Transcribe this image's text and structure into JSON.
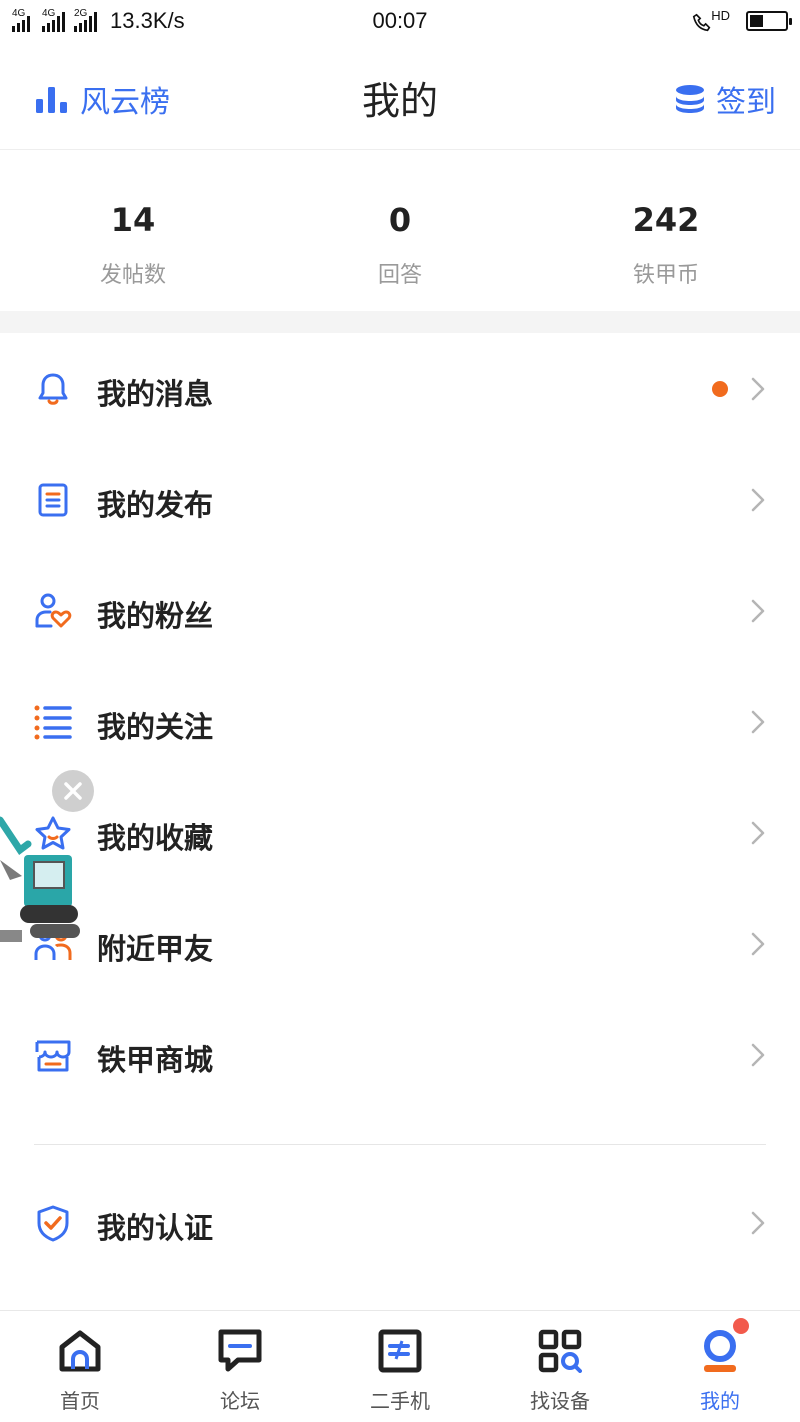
{
  "status_bar": {
    "sim1_tag": "4G",
    "sim2_tag": "4G",
    "sim3_tag": "2G",
    "net_speed": "13.3K/s",
    "time": "00:07",
    "call_tag": "HD",
    "battery_level": 0.35
  },
  "header": {
    "left_label": "风云榜",
    "left_icon": "bar-chart-icon",
    "title": "我的",
    "right_label": "签到",
    "right_icon": "coin-stack-icon",
    "accent_color": "#3a6ff0"
  },
  "stats": [
    {
      "value": "14",
      "label": "发帖数"
    },
    {
      "value": "0",
      "label": "回答"
    },
    {
      "value": "242",
      "label": "铁甲币"
    }
  ],
  "menu": {
    "items": [
      {
        "label": "我的消息",
        "icon": "bell-icon",
        "has_dot": true
      },
      {
        "label": "我的发布",
        "icon": "document-icon"
      },
      {
        "label": "我的粉丝",
        "icon": "fans-icon"
      },
      {
        "label": "我的关注",
        "icon": "list-icon"
      },
      {
        "label": "我的收藏",
        "icon": "star-icon"
      },
      {
        "label": "附近甲友",
        "icon": "people-icon"
      },
      {
        "label": "铁甲商城",
        "icon": "store-icon"
      },
      {
        "label": "我的认证",
        "icon": "shield-check-icon"
      }
    ],
    "dot_color": "#f16b1e"
  },
  "float_ad": {
    "icon": "excavator-icon",
    "close_icon": "close-icon"
  },
  "bottom_nav": {
    "tabs": [
      {
        "label": "首页",
        "icon": "home-icon"
      },
      {
        "label": "论坛",
        "icon": "chat-icon"
      },
      {
        "label": "二手机",
        "icon": "machine-icon"
      },
      {
        "label": "找设备",
        "icon": "grid-search-icon"
      },
      {
        "label": "我的",
        "icon": "profile-icon",
        "active": true
      }
    ],
    "active_color": "#3a6ff0"
  }
}
